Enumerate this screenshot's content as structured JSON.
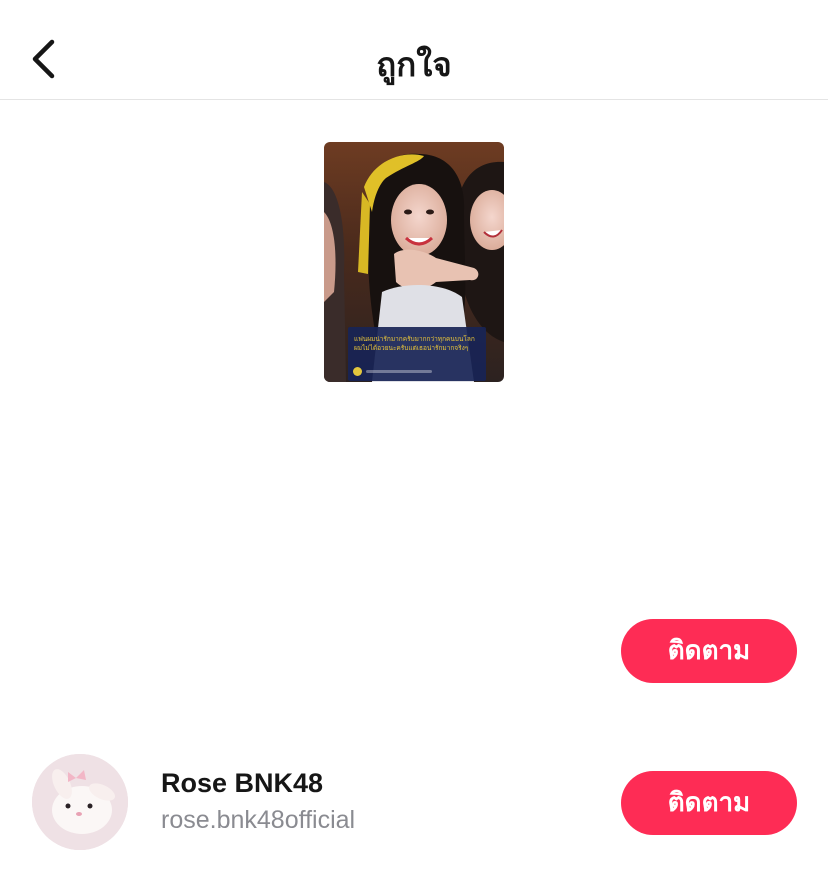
{
  "header": {
    "title": "ถูกใจ",
    "back_icon": "chevron-left-icon"
  },
  "video": {
    "caption_line1": "แฟนผมน่ารักมากครับมากกว่าทุกคนบนโลก",
    "caption_line2": "ผมไม่ได้อวยนะครับแต่เธอน่ารักมากจริงๆ"
  },
  "suggestions": [
    {
      "follow_label": "ติดตาม"
    },
    {
      "name": "Rose BNK48",
      "handle": "rose.bnk48official",
      "follow_label": "ติดตาม"
    }
  ],
  "colors": {
    "accent": "#fe2c55",
    "text_primary": "#161616",
    "text_secondary": "#8a8b91",
    "divider": "#e4e4e4"
  }
}
